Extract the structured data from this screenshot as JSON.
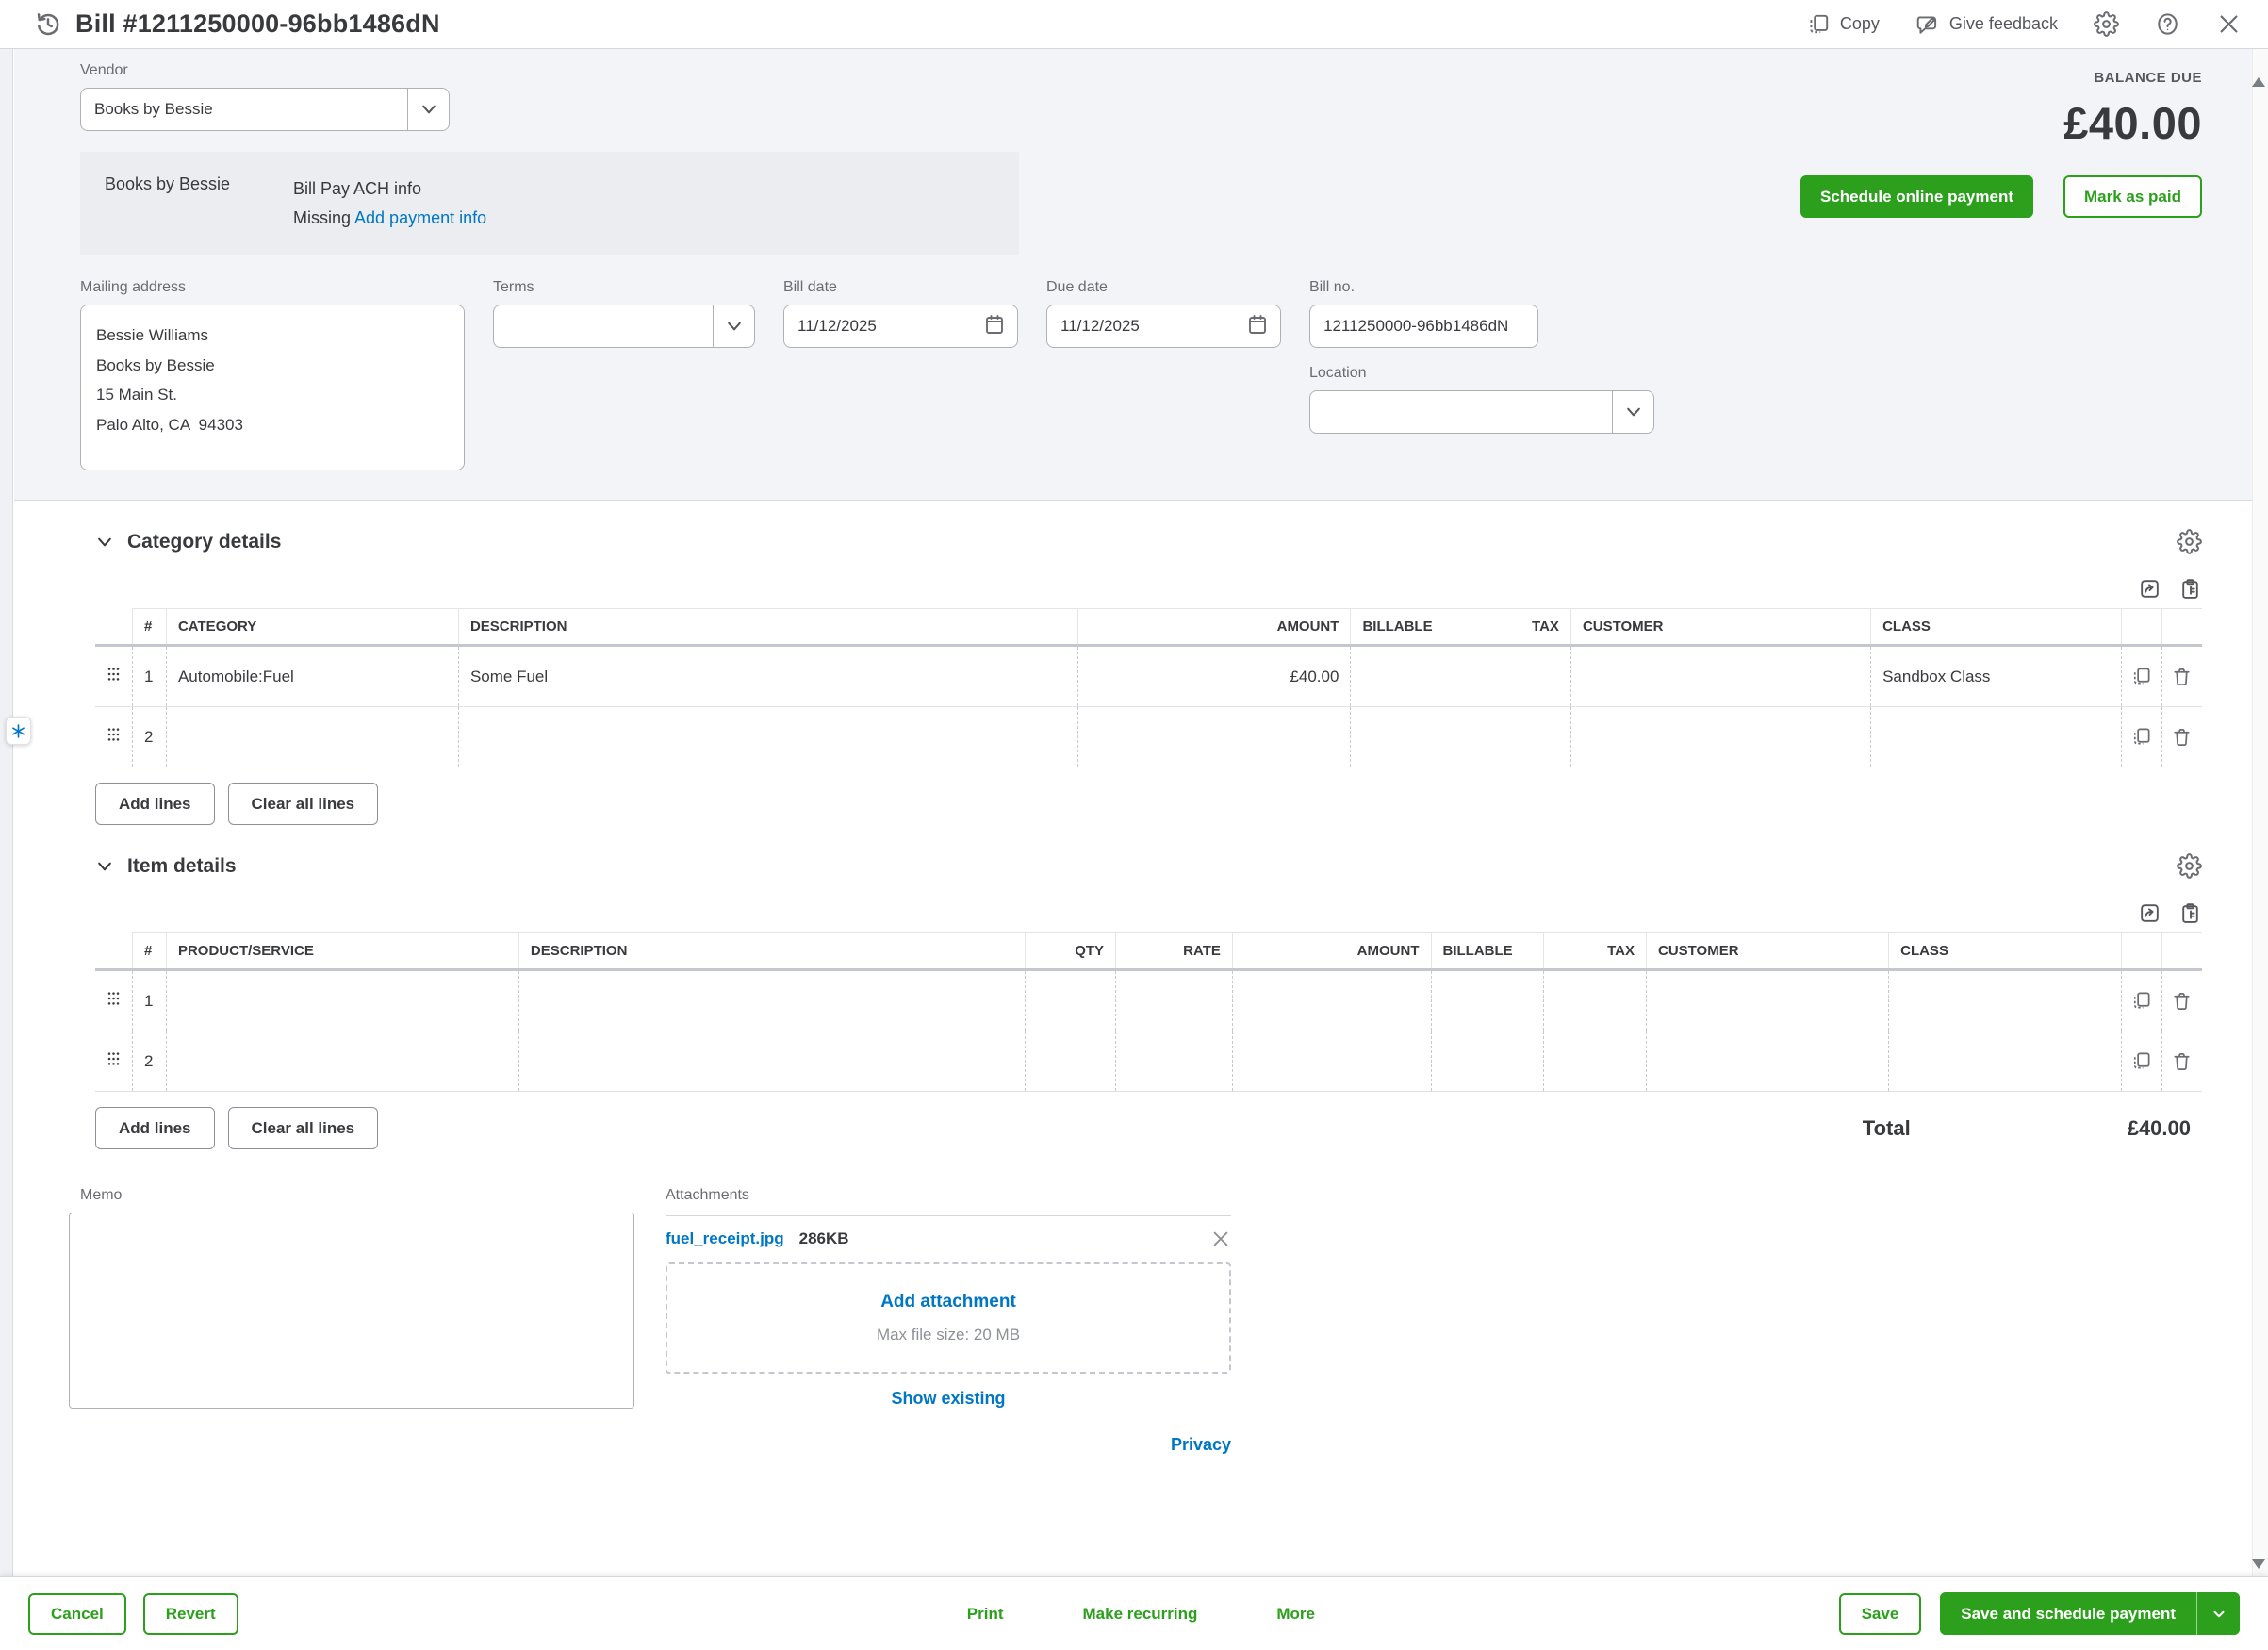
{
  "header": {
    "title": "Bill #1211250000-96bb1486dN",
    "copy": "Copy",
    "give_feedback": "Give feedback"
  },
  "vendor": {
    "label": "Vendor",
    "value": "Books by Bessie"
  },
  "payment_info": {
    "vendor_name": "Books by Bessie",
    "title": "Bill Pay ACH info",
    "status": "Missing",
    "link": "Add payment info"
  },
  "balance": {
    "label": "BALANCE DUE",
    "amount": "£40.00",
    "schedule_button": "Schedule online payment",
    "mark_paid_button": "Mark as paid"
  },
  "fields": {
    "mailing_address": {
      "label": "Mailing address",
      "value": "Bessie Williams\nBooks by Bessie\n15 Main St.\nPalo Alto, CA  94303"
    },
    "terms": {
      "label": "Terms",
      "value": ""
    },
    "bill_date": {
      "label": "Bill date",
      "value": "11/12/2025"
    },
    "due_date": {
      "label": "Due date",
      "value": "11/12/2025"
    },
    "bill_no": {
      "label": "Bill no.",
      "value": "1211250000-96bb1486dN"
    },
    "location": {
      "label": "Location",
      "value": ""
    }
  },
  "category_details": {
    "title": "Category details",
    "columns": {
      "num": "#",
      "category": "CATEGORY",
      "description": "DESCRIPTION",
      "amount": "AMOUNT",
      "billable": "BILLABLE",
      "tax": "TAX",
      "customer": "CUSTOMER",
      "class": "CLASS"
    },
    "rows": [
      {
        "num": "1",
        "category": "Automobile:Fuel",
        "description": "Some Fuel",
        "amount": "£40.00",
        "billable": "",
        "tax": "",
        "customer": "",
        "class": "Sandbox Class"
      },
      {
        "num": "2",
        "category": "",
        "description": "",
        "amount": "",
        "billable": "",
        "tax": "",
        "customer": "",
        "class": ""
      }
    ],
    "add_lines_button": "Add lines",
    "clear_all_button": "Clear all lines"
  },
  "item_details": {
    "title": "Item details",
    "columns": {
      "num": "#",
      "product": "PRODUCT/SERVICE",
      "description": "DESCRIPTION",
      "qty": "QTY",
      "rate": "RATE",
      "amount": "AMOUNT",
      "billable": "BILLABLE",
      "tax": "TAX",
      "customer": "CUSTOMER",
      "class": "CLASS"
    },
    "rows": [
      {
        "num": "1",
        "product": "",
        "description": "",
        "qty": "",
        "rate": "",
        "amount": "",
        "billable": "",
        "tax": "",
        "customer": "",
        "class": ""
      },
      {
        "num": "2",
        "product": "",
        "description": "",
        "qty": "",
        "rate": "",
        "amount": "",
        "billable": "",
        "tax": "",
        "customer": "",
        "class": ""
      }
    ],
    "add_lines_button": "Add lines",
    "clear_all_button": "Clear all lines"
  },
  "totals": {
    "label": "Total",
    "amount": "£40.00"
  },
  "memo": {
    "label": "Memo",
    "value": ""
  },
  "attachments": {
    "label": "Attachments",
    "file": {
      "name": "fuel_receipt.jpg",
      "size": "286KB"
    },
    "add_label": "Add attachment",
    "max_size": "Max file size: 20 MB",
    "show_existing": "Show existing",
    "privacy": "Privacy"
  },
  "footer": {
    "cancel": "Cancel",
    "revert": "Revert",
    "print": "Print",
    "make_recurring": "Make recurring",
    "more": "More",
    "save": "Save",
    "save_and_schedule": "Save and schedule payment"
  },
  "icons": {
    "history-icon": "clock-with-arrow",
    "copy-icon": "two-pages",
    "feedback-icon": "speech-bubble-pencil",
    "gear-icon": "gear",
    "help-icon": "question-circle",
    "close-icon": "x",
    "chevron-down-icon": "v",
    "calendar-icon": "calendar",
    "drag-handle-icon": "dots-grid",
    "duplicate-icon": "two-pages",
    "trash-icon": "trash-can",
    "export-icon": "box-arrow",
    "paste-icon": "clipboard",
    "assistant-icon": "blue-asterisk"
  },
  "colors": {
    "primary_green": "#2ca01c",
    "link_blue": "#0077c5",
    "text_dark": "#393a3d",
    "label_gray": "#6b6c72"
  }
}
